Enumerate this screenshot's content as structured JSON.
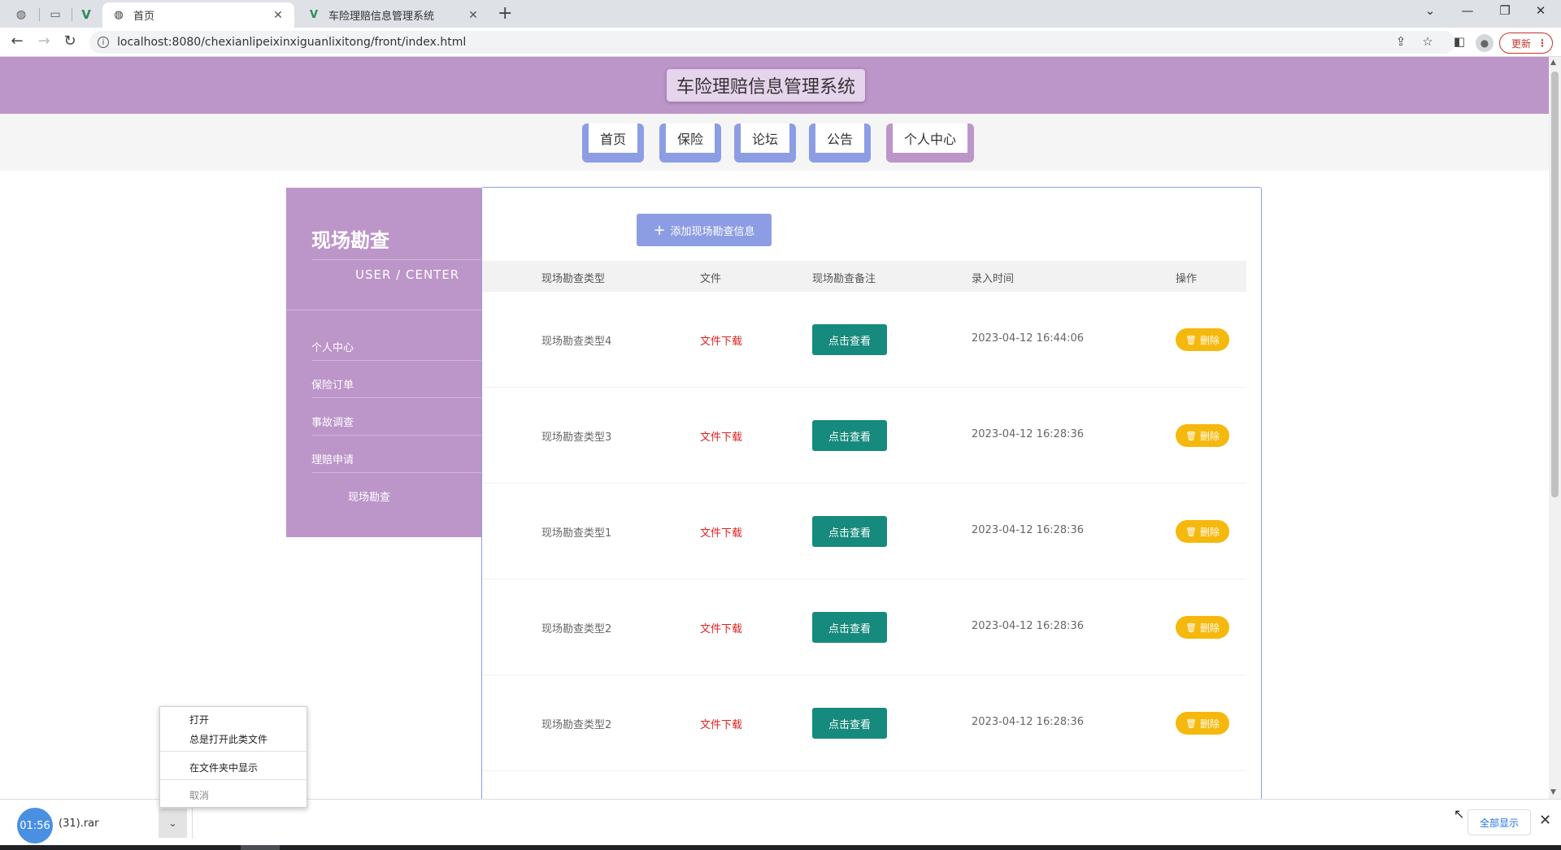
{
  "browser": {
    "tabs": [
      {
        "title": "首页",
        "active": true
      },
      {
        "title": "车险理赔信息管理系统",
        "active": false
      }
    ],
    "url": "localhost:8080/chexianlipeixinxiguanlixitong/front/index.html",
    "update_label": "更新"
  },
  "site": {
    "title": "车险理赔信息管理系统",
    "nav": [
      {
        "label": "首页"
      },
      {
        "label": "保险"
      },
      {
        "label": "论坛"
      },
      {
        "label": "公告"
      },
      {
        "label": "个人中心",
        "active": true
      }
    ]
  },
  "sidebar": {
    "title": "现场勘查",
    "subtitle": "USER / CENTER",
    "items": [
      {
        "label": "个人中心"
      },
      {
        "label": "保险订单"
      },
      {
        "label": "事故调查"
      },
      {
        "label": "理赔申请"
      },
      {
        "label": "现场勘查",
        "active": true
      }
    ]
  },
  "main": {
    "add_button": "添加现场勘查信息",
    "columns": [
      "现场勘查类型",
      "文件",
      "现场勘查备注",
      "录入时间",
      "操作"
    ],
    "rows": [
      {
        "type": "现场勘查类型4",
        "file": "文件下载",
        "note": "点击查看",
        "time": "2023-04-12 16:44:06",
        "action": "删除"
      },
      {
        "type": "现场勘查类型3",
        "file": "文件下载",
        "note": "点击查看",
        "time": "2023-04-12 16:28:36",
        "action": "删除"
      },
      {
        "type": "现场勘查类型1",
        "file": "文件下载",
        "note": "点击查看",
        "time": "2023-04-12 16:28:36",
        "action": "删除"
      },
      {
        "type": "现场勘查类型2",
        "file": "文件下载",
        "note": "点击查看",
        "time": "2023-04-12 16:28:36",
        "action": "删除"
      },
      {
        "type": "现场勘查类型2",
        "file": "文件下载",
        "note": "点击查看",
        "time": "2023-04-12 16:28:36",
        "action": "删除"
      }
    ]
  },
  "download_bar": {
    "timer": "01:56",
    "filename": "(31).rar",
    "show_all": "全部显示"
  },
  "context_menu": {
    "items": [
      "打开",
      "总是打开此类文件",
      "在文件夹中显示",
      "取消"
    ]
  },
  "colors": {
    "header": "#bc95c9",
    "nav_button": "#8d9de4",
    "view_button": "#168a7c",
    "delete_button": "#f5b80d",
    "download_link": "#e02020"
  }
}
